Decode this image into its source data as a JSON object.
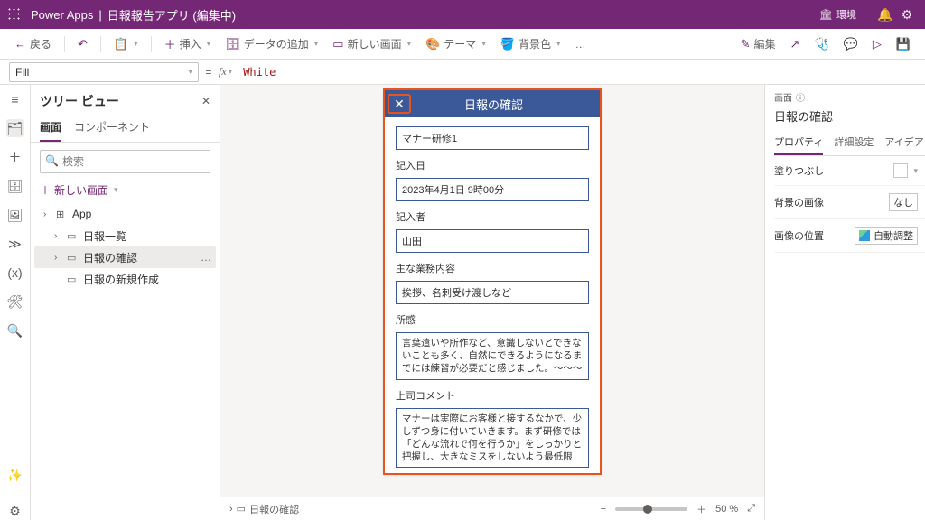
{
  "topbar": {
    "product": "Power Apps",
    "separator": "|",
    "app_title": "日報報告アプリ (編集中)",
    "environment_label": "環境"
  },
  "commands": {
    "back": "戻る",
    "insert": "挿入",
    "add_data": "データの追加",
    "new_screen": "新しい画面",
    "theme": "テーマ",
    "bg_color": "背景色",
    "more": "…",
    "edit": "編集"
  },
  "formula": {
    "property": "Fill",
    "equals": "=",
    "fx": "fx",
    "value": "White"
  },
  "tree": {
    "title": "ツリー ビュー",
    "tab_screens": "画面",
    "tab_components": "コンポーネント",
    "search_placeholder": "検索",
    "new_screen": "新しい画面",
    "items": [
      {
        "label": "App",
        "icon": "⊞"
      },
      {
        "label": "日報一覧",
        "icon": "▭"
      },
      {
        "label": "日報の確認",
        "icon": "▭",
        "selected": true
      },
      {
        "label": "日報の新規作成",
        "icon": "▭"
      }
    ]
  },
  "canvas": {
    "header_title": "日報の確認",
    "fields": [
      {
        "label": null,
        "value": "マナー研修1"
      },
      {
        "label": "記入日",
        "value": "2023年4月1日 9時00分"
      },
      {
        "label": "記入者",
        "value": "山田"
      },
      {
        "label": "主な業務内容",
        "value": "挨拶、名刺受け渡しなど"
      },
      {
        "label": "所感",
        "value": "言葉遣いや所作など、意識しないとできないことも多く、自然にできるようになるまでには練習が必要だと感じました。～～～"
      },
      {
        "label": "上司コメント",
        "value": "マナーは実際にお客様と接するなかで、少しずつ身に付いていきます。まず研修では「どんな流れで何を行うか」をしっかりと把握し、大きなミスをしないよう最低限"
      }
    ],
    "footer_name": "日報の確認",
    "zoom": "50 %"
  },
  "props": {
    "section_label": "画面",
    "selected_name": "日報の確認",
    "tab_prop": "プロパティ",
    "tab_adv": "詳細設定",
    "tab_idea": "アイデア",
    "rows": {
      "fill": "塗りつぶし",
      "bg_image": "背景の画像",
      "bg_image_val": "なし",
      "img_pos": "画像の位置",
      "img_pos_val": "自動調整"
    }
  }
}
